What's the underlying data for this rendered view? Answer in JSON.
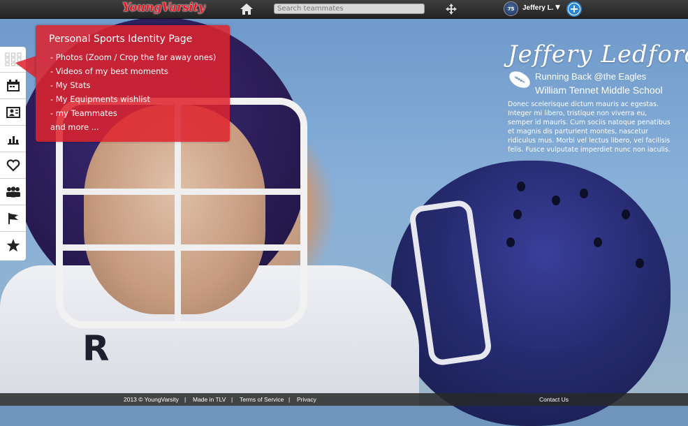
{
  "header": {
    "logo": "YoungVarsity",
    "search_placeholder": "Search teammates",
    "username": "Jeffery L.",
    "caret": "▼",
    "avatar_number": "75",
    "plus_symbol": "+"
  },
  "sidebar": {
    "items": [
      {
        "icon": "grid-icon"
      },
      {
        "icon": "calendar-icon"
      },
      {
        "icon": "profile-card-icon"
      },
      {
        "icon": "stats-icon"
      },
      {
        "icon": "heart-icon"
      },
      {
        "icon": "team-icon"
      },
      {
        "icon": "flag-icon"
      },
      {
        "icon": "star-icon"
      }
    ]
  },
  "popup": {
    "title": "Personal Sports Identity Page",
    "items": [
      "- Photos (Zoom / Crop the far away ones)",
      "- Videos of my best moments",
      "- My Stats",
      "- My Equipments wishlist",
      "- my Teammates",
      "and more ..."
    ]
  },
  "profile": {
    "name": "Jeffery Ledford",
    "position": "Running Back @the Eagles",
    "school": "William Tennet Middle School",
    "bio": "Donec scelerisque dictum mauris ac egestas. Integer mi libero, tristique non viverra eu, semper id mauris. Cum sociis natoque penatibus et magnis dis parturient montes, nascetur ridiculus mus. Morbi vel lectus libero, vel facilisis felis. Fusce vulputate imperdiet nunc non iaculis."
  },
  "photo": {
    "jersey_letter": "R"
  },
  "footer": {
    "copyright": "2013 © YoungVarsity",
    "sep": "|",
    "made_in": "Made in TLV",
    "terms": "Terms of Service",
    "privacy": "Privacy",
    "contact": "Contact Us"
  },
  "colors": {
    "brand_red": "#e21f2a",
    "popup_red": "#de232d",
    "accent_blue": "#2b87d6",
    "topbar": "#2d2d2d"
  }
}
